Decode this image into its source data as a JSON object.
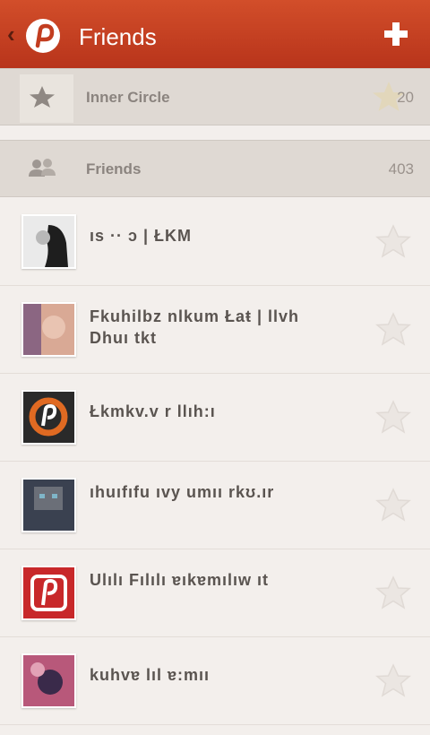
{
  "header": {
    "title": "Friends",
    "back_icon": "chevron-left-icon",
    "logo_icon": "pinterest-logo-icon",
    "add_icon": "plus-icon",
    "bar_color": "#c23d20"
  },
  "sections": [
    {
      "label": "Inner Circle",
      "count": "20",
      "icon": "star-icon"
    },
    {
      "label": "Friends",
      "count": "403",
      "icon": "people-icon"
    }
  ],
  "friends": [
    {
      "name": "ıs  ·· ɔ | ŁKM",
      "avatar_color": "#e8e8e8",
      "avatar_accent": "#222222",
      "two_line": false
    },
    {
      "name": "Fkuhilbz nlkum Łaŧ | llvh Dhuı tkt",
      "avatar_color": "#d3a08c",
      "avatar_accent": "#6a4a7a",
      "two_line": true
    },
    {
      "name": "Łkmkv.v r llıh:ı",
      "avatar_color": "#2a2a2a",
      "avatar_accent": "#e06a22",
      "two_line": false
    },
    {
      "name": "ıhuıfıfu   ıvy umıı rkʊ.ır",
      "avatar_color": "#3a4150",
      "avatar_accent": "#7fb5c8",
      "two_line": true
    },
    {
      "name": "Ulılı Fılılı  ɐıkɐmılıw ıt",
      "avatar_color": "#c8282a",
      "avatar_accent": "#ffffff",
      "two_line": true
    },
    {
      "name": "kuhvɐ   lıl ɐ:mıı",
      "avatar_color": "#b8587a",
      "avatar_accent": "#3a2a4a",
      "two_line": false
    }
  ],
  "star_icon": "star-outline-icon"
}
